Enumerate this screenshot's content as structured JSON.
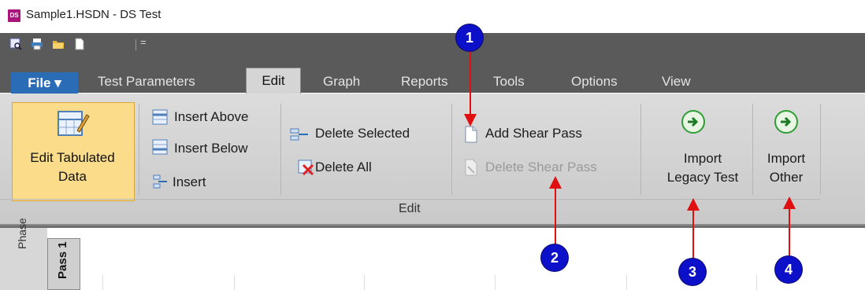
{
  "window": {
    "title": "Sample1.HSDN - DS Test",
    "app_badge": "DS"
  },
  "qat": {
    "icons": [
      "preview-icon",
      "print-icon",
      "open-folder-icon",
      "new-document-icon"
    ],
    "more": "="
  },
  "tabs": [
    "File ▾",
    "Test Parameters",
    "Edit",
    "Graph",
    "Reports",
    "Tools",
    "Options",
    "View"
  ],
  "ribbon": {
    "edit_tabulated_data": [
      "Edit Tabulated",
      "Data"
    ],
    "insert_above": "Insert Above",
    "insert_below": "Insert Below",
    "insert": "Insert",
    "delete_selected": "Delete Selected",
    "delete_all": "Delete All",
    "add_shear_pass": "Add Shear Pass",
    "delete_shear_pass": "Delete Shear Pass",
    "import_legacy": [
      "Import",
      "Legacy Test"
    ],
    "import_other": [
      "Import",
      "Other"
    ],
    "group_label": "Edit"
  },
  "sheet": {
    "side_label": "Phase",
    "tab_label": "Pass 1"
  },
  "annotations": [
    "1",
    "2",
    "3",
    "4"
  ],
  "colors": {
    "annotation": "#0d10c9",
    "arrow": "#e01010",
    "file_tab": "#2b6cb6",
    "highlight": "#fbdc8a"
  }
}
